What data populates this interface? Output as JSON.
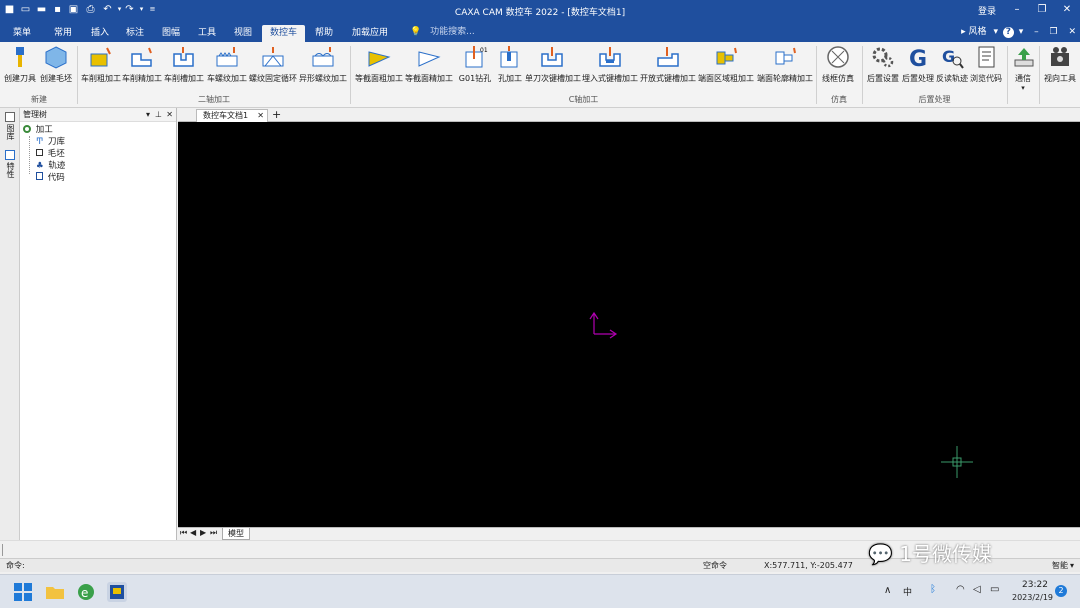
{
  "titlebar": {
    "title": "CAXA CAM 数控车 2022 - [数控车文档1]",
    "login": "登录",
    "quick_access": [
      "new-icon",
      "open-icon",
      "save-icon",
      "save-all-icon",
      "print-icon",
      "undo-icon",
      "redo-icon",
      "customize-icon"
    ]
  },
  "menu_tabs": [
    "菜单",
    "常用",
    "插入",
    "标注",
    "图幅",
    "工具",
    "视图",
    "数控车",
    "帮助",
    "加载应用"
  ],
  "active_tab": "数控车",
  "search": {
    "placeholder": "功能搜索..."
  },
  "right_tools": {
    "style": "风格"
  },
  "ribbon": {
    "groups": [
      {
        "label": "新建",
        "buttons": [
          "创建刀具",
          "创建毛坯"
        ]
      },
      {
        "label": "二轴加工",
        "buttons": [
          "车削粗加工",
          "车削精加工",
          "车削槽加工",
          "车螺纹加工",
          "螺纹固定循环",
          "异形螺纹加工"
        ]
      },
      {
        "label": "C轴加工",
        "buttons": [
          "等截面粗加工",
          "等截面精加工",
          "G01钻孔",
          "孔加工",
          "单刀次键槽加工",
          "埋入式键槽加工",
          "开放式键槽加工",
          "端面区域粗加工",
          "端面轮廓精加工"
        ]
      },
      {
        "label": "仿真",
        "buttons": [
          "线框仿真"
        ]
      },
      {
        "label": "后置处理",
        "buttons": [
          "后置设置",
          "后置处理",
          "反读轨迹",
          "浏览代码"
        ]
      },
      {
        "label": "",
        "buttons": [
          "通信"
        ]
      },
      {
        "label": "",
        "buttons": [
          "视向工具"
        ]
      }
    ]
  },
  "left_strip": [
    "图库",
    "特性"
  ],
  "manager": {
    "title": "管理树",
    "tree": [
      {
        "label": "加工",
        "icon": "machining-icon"
      },
      {
        "label": "刀库",
        "icon": "tool-icon"
      },
      {
        "label": "毛坯",
        "icon": "blank-icon"
      },
      {
        "label": "轨迹",
        "icon": "path-icon"
      },
      {
        "label": "代码",
        "icon": "code-icon"
      }
    ]
  },
  "document_tab": "数控车文档1",
  "model_tab": "模型",
  "command": {
    "prompt": "命令:",
    "state": "空命令",
    "coords": "X:577.711, Y:-205.477",
    "mode": "智能"
  },
  "taskbar": {
    "time": "23:22",
    "date": "2023/2/19",
    "ime": "中",
    "notif": "2"
  },
  "watermark": "1号微传媒",
  "colors": {
    "accent": "#1f4f9e",
    "canvas": "#000000",
    "axis": "#b000b0",
    "cursor": "#3a9a6a"
  }
}
